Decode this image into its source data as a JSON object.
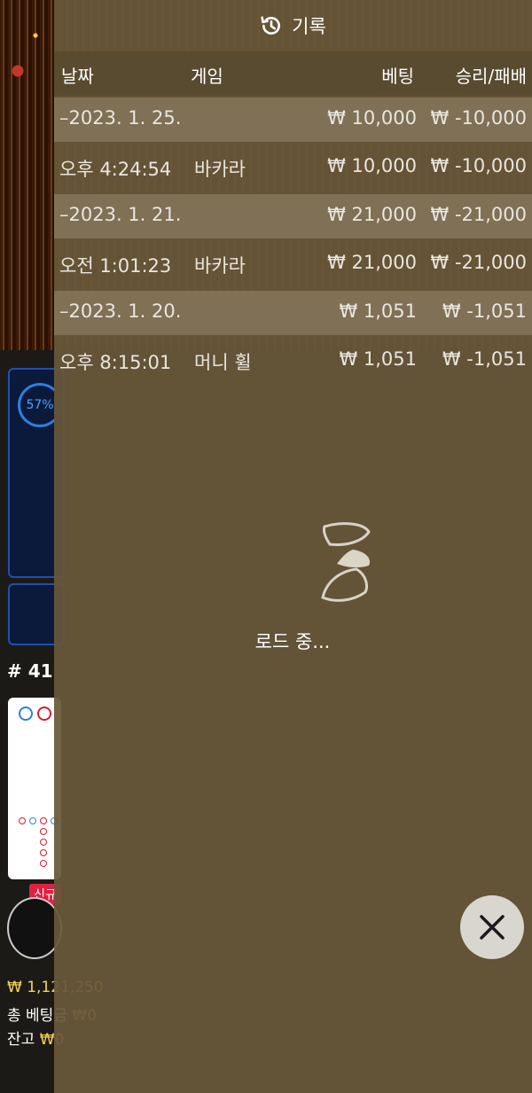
{
  "panel": {
    "title": "기록",
    "icon": "history-icon",
    "columns": {
      "date": "날짜",
      "game": "게임",
      "bet": "베팅",
      "result": "승리/패배"
    },
    "rows": [
      {
        "type": "date",
        "label": "–2023. 1. 25.",
        "bet": "₩ 10,000",
        "result": "₩ -10,000"
      },
      {
        "type": "entry",
        "time": "오후 4:24:54",
        "game": "바카라",
        "bet": "₩ 10,000",
        "result": "₩ -10,000"
      },
      {
        "type": "date",
        "label": "–2023. 1. 21.",
        "bet": "₩ 21,000",
        "result": "₩ -21,000"
      },
      {
        "type": "entry",
        "time": "오전 1:01:23",
        "game": "바카라",
        "bet": "₩ 21,000",
        "result": "₩ -21,000"
      },
      {
        "type": "date",
        "label": "–2023. 1. 20.",
        "bet": "₩ 1,051",
        "result": "₩ -1,051"
      },
      {
        "type": "entry",
        "time": "오후 8:15:01",
        "game": "머니 휠",
        "bet": "₩ 1,051",
        "result": "₩ -1,051"
      }
    ],
    "loading_text": "로드 중..."
  },
  "background": {
    "progress_percent": "57%",
    "round_label": "# 41",
    "new_badge": "신규",
    "balance_amount": "₩ 1,121,250",
    "total_bet_label": "총 베팅금",
    "total_bet_value": "₩0",
    "balance_label": "잔고",
    "balance_value": "₩0"
  },
  "colors": {
    "panel_bg": "#68583a",
    "date_row_bg": "#84765c",
    "accent_blue": "#2d7fe0",
    "badge_red": "#e02040",
    "gold": "#f5d35a"
  }
}
